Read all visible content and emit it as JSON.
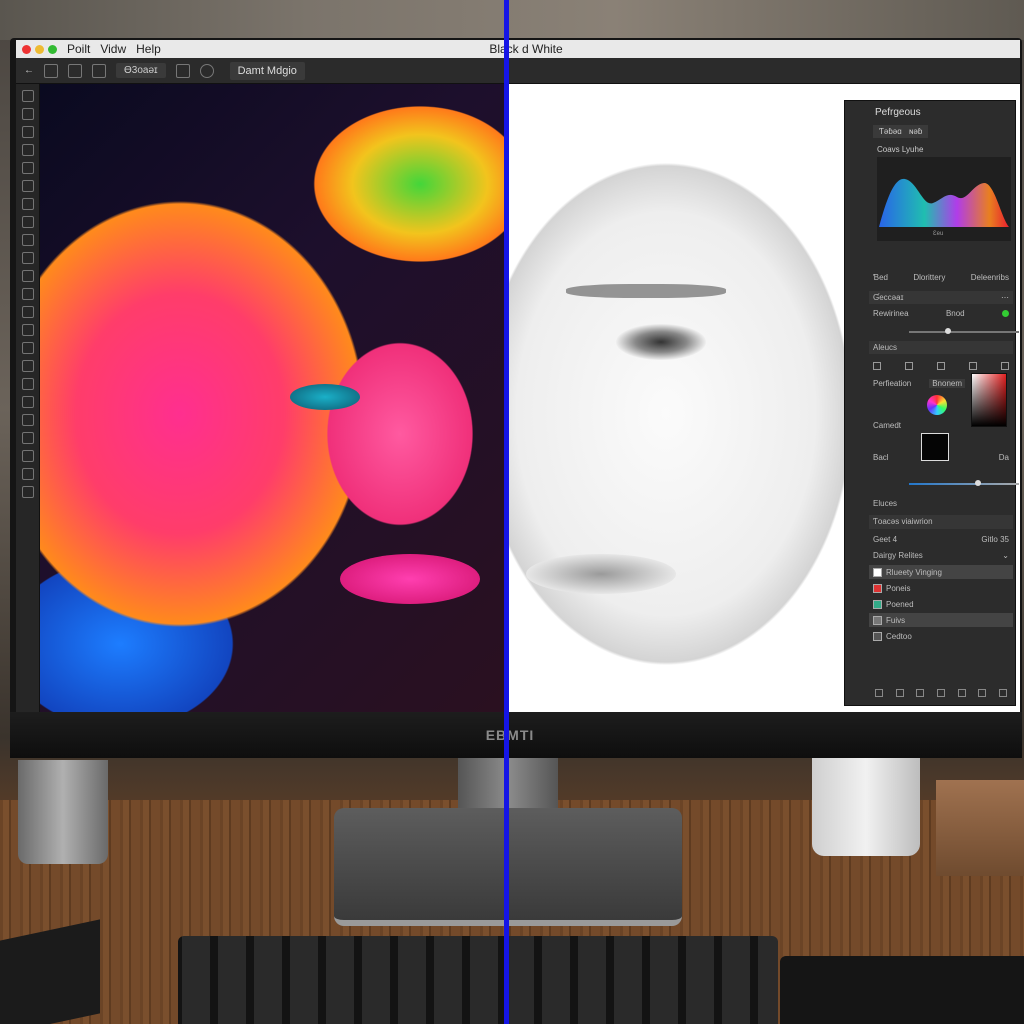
{
  "menubar": {
    "items": [
      "Poilt",
      "Vidw",
      "Help"
    ],
    "document_title": "Black d White"
  },
  "options_bar": {
    "field": "Ɵ3oaəɪ",
    "preset": "Damt Mdgio"
  },
  "panel": {
    "title": "Pefrgeous",
    "tabs": [
      "Ƭəɓəɑ",
      "ɴəɓ"
    ],
    "histogram_label": "Coavs Lyuhe",
    "histogram_axis": "Ɛeu",
    "row1": [
      "Ɓed",
      "Dlorittery",
      "Deleenribs"
    ],
    "section1": "Ɠeccəaɪ",
    "row2": [
      "Rewirinea",
      "Bnod"
    ],
    "section2": "Aleucs",
    "row3": [
      "Perfieation",
      "Bnonem"
    ],
    "row4": [
      "Camedt"
    ],
    "row5": [
      "Bacl",
      "Da"
    ],
    "section3": "Eluces",
    "layers_search": "Ƭoacəs viaiwrion",
    "layers_opts": [
      "Geet 4",
      "Gitlo 35"
    ],
    "layers_group": "Dairgy Relites",
    "layers": [
      {
        "name": "Rlueety Vinging",
        "selected": true
      },
      {
        "name": "Poneis",
        "selected": false
      },
      {
        "name": "Poened",
        "selected": false
      },
      {
        "name": "Fuivs",
        "selected": true
      },
      {
        "name": "Cedtoo",
        "selected": false
      }
    ]
  },
  "monitor": {
    "brand": "EBMTI"
  },
  "colors": {
    "divider": "#1515e6",
    "menubar": "#e9e9e9",
    "panel": "#2c2c2c"
  }
}
